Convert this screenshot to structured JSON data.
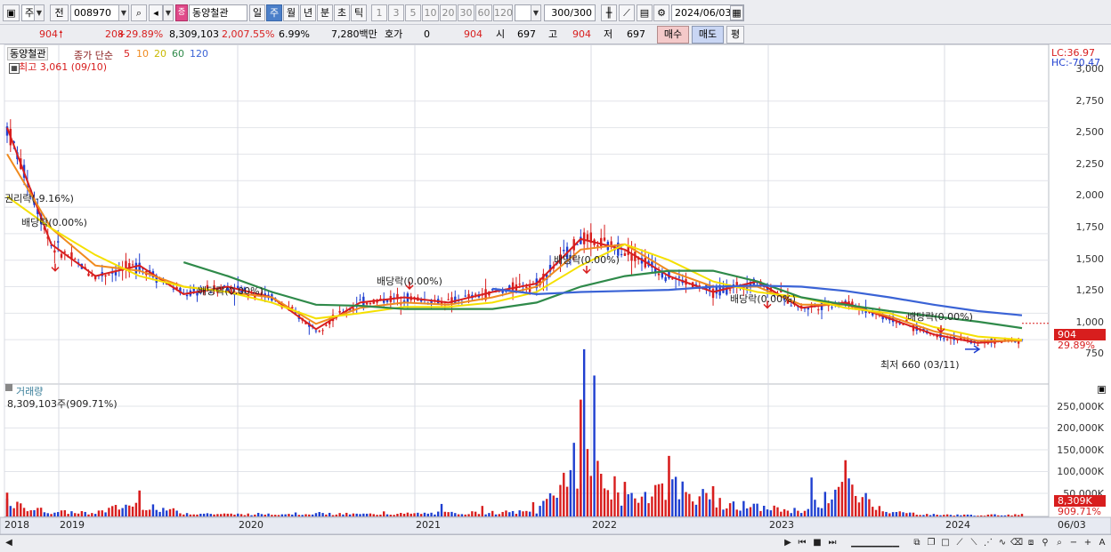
{
  "toolbar": {
    "market_type": "주",
    "prev_label": "전",
    "code": "008970",
    "stock_name": "동양철관",
    "periods": [
      "일",
      "주",
      "월",
      "년",
      "분",
      "초",
      "틱"
    ],
    "active_period": "주",
    "minute_options": [
      "1",
      "3",
      "5",
      "10",
      "20",
      "30",
      "60",
      "120"
    ],
    "count": "300",
    "count_total": "/300",
    "date": "2024/06/03"
  },
  "quote": {
    "price": "904",
    "change": "208",
    "change_pct": "+29.89%",
    "volume": "8,309,103",
    "volume_pct": "2,007.55%",
    "turnover": "6.99%",
    "amount": "7,280백만",
    "hoga_label": "호가",
    "hoga_value": "0",
    "hoga_price": "904",
    "open_label": "시",
    "open": "697",
    "high_label": "고",
    "high": "904",
    "low_label": "저",
    "low": "697",
    "buy_label": "매수",
    "sell_label": "매도",
    "eval_label": "평"
  },
  "price_panel": {
    "stock_tag": "동양철관",
    "ma_header": "종가 단순",
    "ma_periods": [
      "5",
      "10",
      "20",
      "60",
      "120"
    ],
    "high_note": "최고 3,061 (09/10)",
    "low_note": "최저 660 (03/11)",
    "lc": "LC:36.97",
    "hc": "HC:-70.47",
    "price_tag": "904",
    "pct_tag": "29.89%",
    "annotations": [
      {
        "text": "권리락(-9.16%)"
      },
      {
        "text": "배당락(0.00%)"
      },
      {
        "text": "배당락(0.00%)"
      },
      {
        "text": "배당락(0.00%)"
      },
      {
        "text": "배당락(0.00%)"
      },
      {
        "text": "배당락(0.00%)"
      },
      {
        "text": "배당락(0.00%)"
      }
    ]
  },
  "volume_panel": {
    "title": "거래량",
    "summary": "8,309,103주(909.71%)",
    "tag": "8,309K",
    "tag_pct": "909.71%",
    "yticks": [
      "250,000K",
      "200,000K",
      "150,000K",
      "100,000K",
      "50,000K"
    ]
  },
  "colors": {
    "up": "#d81e1e",
    "down": "#1f3fd0",
    "ma5": "#d81e1e",
    "ma10": "#f08a1e",
    "ma20": "#f5e000",
    "ma60": "#2f8a4a",
    "ma120": "#3a63d6"
  },
  "chart_data": {
    "type": "line",
    "title": "",
    "x": [
      "2018",
      "2019",
      "2020",
      "2021",
      "2022",
      "2023",
      "2024",
      "06/03"
    ],
    "ylim": [
      660,
      3061
    ],
    "yticks": [
      "3,000",
      "2,750",
      "2,500",
      "2,250",
      "2,000",
      "1,750",
      "1,500",
      "1,250",
      "1,000",
      "750"
    ],
    "series": [
      {
        "name": "5",
        "values": [
          2750,
          1650,
          1350,
          1450,
          1180,
          1250,
          1150,
          850,
          1100,
          1150,
          1100,
          1200,
          1280,
          1700,
          1600,
          1350,
          1200,
          1300,
          1050,
          1100,
          950,
          800,
          720,
          750
        ]
      },
      {
        "name": "10",
        "values": [
          2500,
          1800,
          1450,
          1400,
          1250,
          1200,
          1150,
          900,
          1050,
          1100,
          1080,
          1150,
          1250,
          1600,
          1650,
          1400,
          1250,
          1250,
          1080,
          1080,
          970,
          830,
          740,
          740
        ]
      },
      {
        "name": "20",
        "values": [
          2100,
          1800,
          1550,
          1350,
          1250,
          1200,
          1100,
          950,
          1000,
          1060,
          1060,
          1100,
          1200,
          1450,
          1650,
          1500,
          1300,
          1200,
          1150,
          1050,
          1000,
          870,
          780,
          750
        ]
      },
      {
        "name": "60",
        "values": [
          null,
          null,
          null,
          null,
          1480,
          1350,
          1200,
          1080,
          1070,
          1040,
          1040,
          1040,
          1100,
          1250,
          1350,
          1400,
          1400,
          1300,
          1150,
          1080,
          1020,
          970,
          920,
          860
        ]
      },
      {
        "name": "120",
        "values": [
          null,
          null,
          null,
          null,
          null,
          null,
          null,
          null,
          null,
          null,
          null,
          1230,
          1180,
          1200,
          1210,
          1220,
          1250,
          1260,
          1250,
          1210,
          1150,
          1080,
          1020,
          980
        ]
      }
    ],
    "volume": {
      "unit": "K",
      "values": [
        55000,
        20000,
        18000,
        60000,
        15000,
        10000,
        12000,
        14000,
        10000,
        12000,
        15000,
        18000,
        20000,
        270000,
        80000,
        140000,
        70000,
        40000,
        25000,
        130000,
        20000,
        8000,
        6000,
        8309
      ]
    }
  }
}
